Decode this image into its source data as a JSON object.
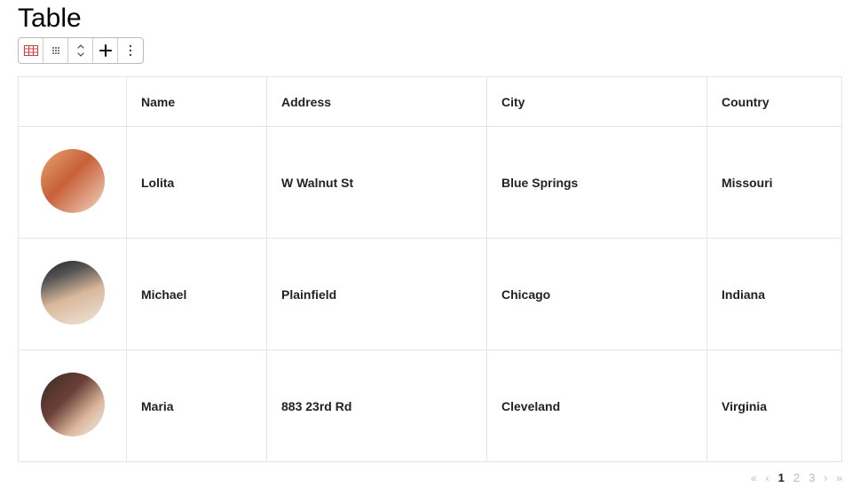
{
  "title": "Table",
  "columns": {
    "name": "Name",
    "address": "Address",
    "city": "City",
    "country": "Country"
  },
  "rows": [
    {
      "name": "Lolita",
      "address": "W Walnut St",
      "city": "Blue Springs",
      "country": "Missouri",
      "avatarClass": "av-1"
    },
    {
      "name": "Michael",
      "address": "Plainfield",
      "city": "Chicago",
      "country": "Indiana",
      "avatarClass": "av-2"
    },
    {
      "name": "Maria",
      "address": "883 23rd Rd",
      "city": "Cleveland",
      "country": "Virginia",
      "avatarClass": "av-3"
    }
  ],
  "pagination": {
    "first": "«",
    "prev": "‹",
    "pages": [
      "1",
      "2",
      "3"
    ],
    "activeIndex": 0,
    "next": "›",
    "last": "»"
  }
}
